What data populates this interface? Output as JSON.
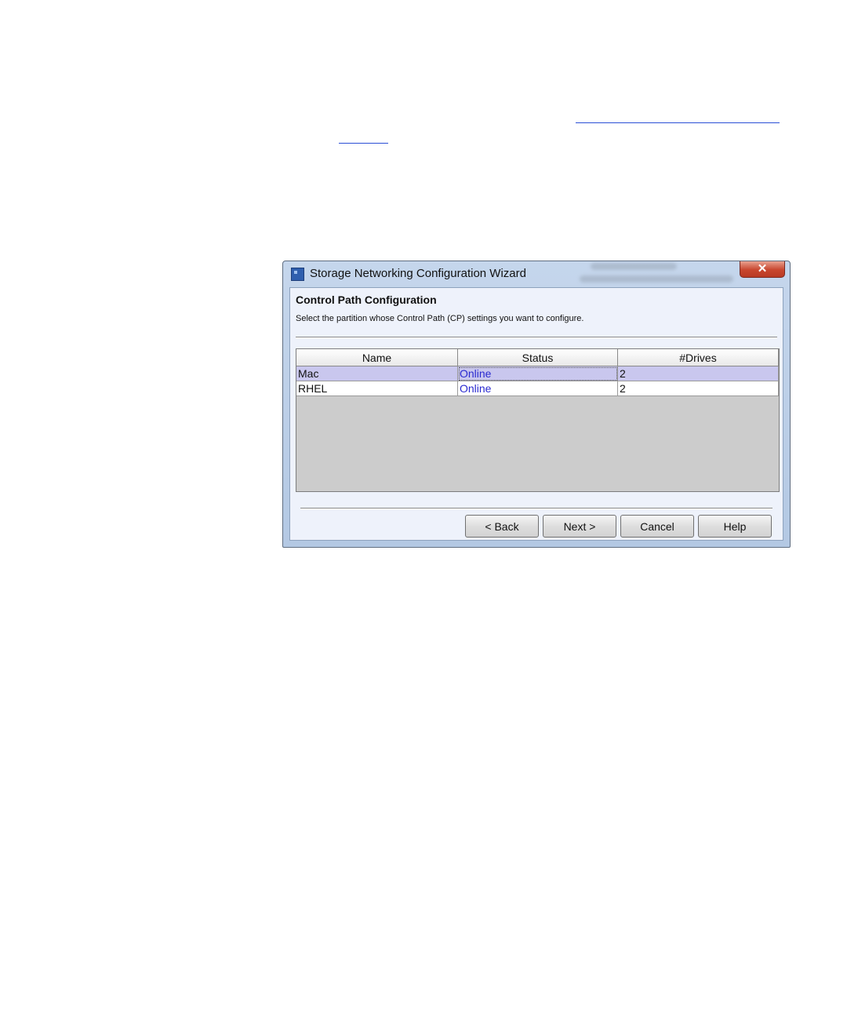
{
  "window": {
    "title": "Storage Networking Configuration Wizard",
    "close_symbol": "✕"
  },
  "page": {
    "heading": "Control Path Configuration",
    "instruction": "Select the partition whose Control Path (CP) settings you want to configure."
  },
  "table": {
    "columns": [
      "Name",
      "Status",
      "#Drives"
    ],
    "rows": [
      {
        "name": "Mac",
        "status": "Online",
        "drives": "2",
        "selected": true
      },
      {
        "name": "RHEL",
        "status": "Online",
        "drives": "2",
        "selected": false
      }
    ]
  },
  "buttons": {
    "back": "< Back",
    "next": "Next >",
    "cancel": "Cancel",
    "help": "Help"
  },
  "icons": {
    "app": "wizard-app-icon",
    "close": "close-icon"
  },
  "colors": {
    "selected_row": "#c9c7ee",
    "status_text": "#2a2ad0",
    "link_underline": "#2b4fd6",
    "close_button": "#c8462e"
  }
}
